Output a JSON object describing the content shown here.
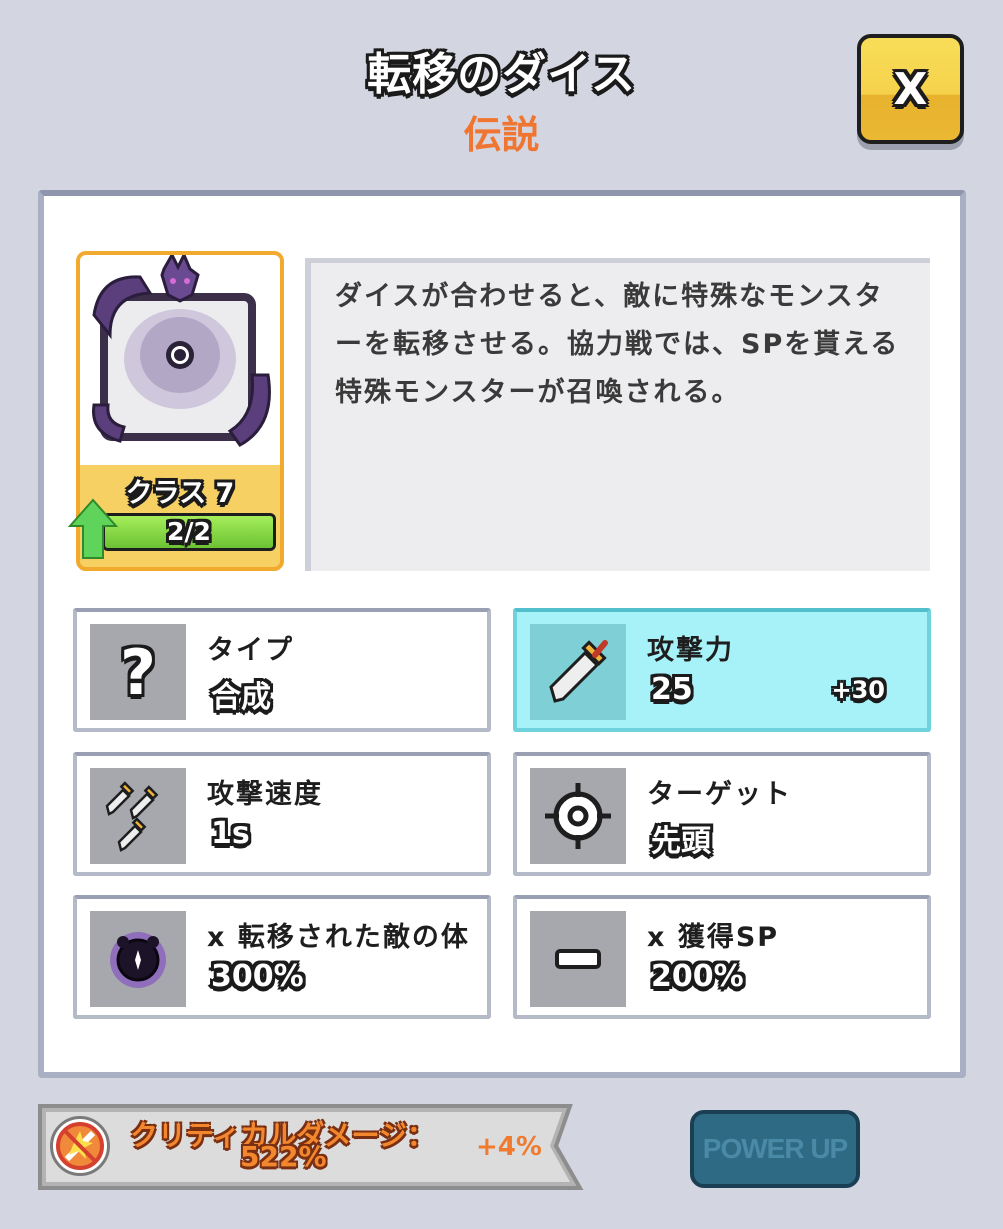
{
  "header": {
    "title": "転移のダイス",
    "rarity": "伝説",
    "close_label": "X"
  },
  "card": {
    "class_label": "クラス 7",
    "level_text": "2/2",
    "level_progress": 1.0,
    "upgrade_icon": "up-arrow-icon"
  },
  "description": "ダイスが合わせると、敵に特殊なモンスターを転移させる。協力戦では、SPを貰える特殊モンスターが召喚される。",
  "stats": [
    {
      "label": "タイプ",
      "value": "合成",
      "bonus": "",
      "icon": "question-icon",
      "highlight": false
    },
    {
      "label": "攻撃力",
      "value": "25",
      "bonus": "+30",
      "icon": "sword-icon",
      "highlight": true
    },
    {
      "label": "攻撃速度",
      "value": "1s",
      "bonus": "",
      "icon": "triple-sword-icon",
      "highlight": false
    },
    {
      "label": "ターゲット",
      "value": "先頭",
      "bonus": "",
      "icon": "crosshair-icon",
      "highlight": false
    },
    {
      "label": "x 転移された敵の体力",
      "value": "300%",
      "bonus": "",
      "icon": "dark-orb-icon",
      "highlight": false
    },
    {
      "label": "x 獲得SP",
      "value": "200%",
      "bonus": "",
      "icon": "minus-icon",
      "highlight": false
    }
  ],
  "footer": {
    "crit_label": "クリティカルダメージ：",
    "crit_value": "522%",
    "crit_bonus": "+4%",
    "power_up_label": "POWER UP"
  },
  "colors": {
    "background": "#d3d6e1",
    "rarity": "#f07530",
    "close_button": "#f6d24c",
    "highlight_stat": "#a7f1f8",
    "power_up_button": "#2f6a84"
  }
}
